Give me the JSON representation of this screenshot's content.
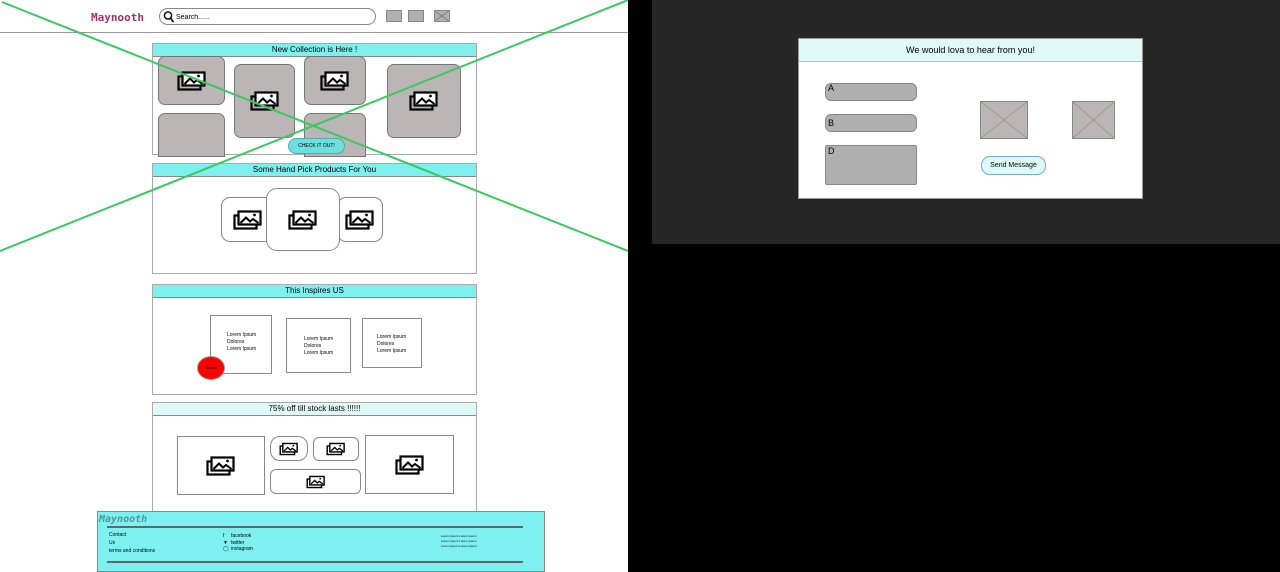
{
  "header": {
    "logo": "Maynooth",
    "search_placeholder": "Search......"
  },
  "sections": {
    "collection": {
      "title": "New Collection is Here !",
      "button": "CHECK IT OUT!"
    },
    "handpick": {
      "title": "Some Hand Pick Products For You"
    },
    "inspire": {
      "title": "This  Inspires US",
      "cards": [
        [
          "Lorem Ipsum",
          "Dolores",
          "Lorem Ipsum"
        ],
        [
          "Lorem Ipsum",
          "Dolores",
          "Lorem Ipsum"
        ],
        [
          "Lorem Ipsum",
          "Dolores",
          "Lorem Ipsum"
        ]
      ],
      "red_button": "Button"
    },
    "sale": {
      "title": "75% off till stock lasts !!!!!!"
    }
  },
  "footer": {
    "logo": "Maynooth",
    "links": [
      "Contact",
      "Us",
      "terms and conditions"
    ],
    "social": [
      "facebook",
      "twitter",
      "instagram"
    ],
    "lorem": [
      "Lorem ipsum Lorem ipsum",
      "Lorem ipsum Lorem ipsum",
      "Lorem ipsum Lorem ipsum"
    ]
  },
  "contact": {
    "title": "We would lova to hear from you!",
    "fields": [
      "A",
      "B",
      "D"
    ],
    "send_button": "Send Message"
  },
  "colors": {
    "accent": "#7ff0f0",
    "light_accent": "#dff9f9",
    "logo": "#a0306a",
    "cross": "#3cc860",
    "red": "#ff0000"
  },
  "icons": [
    "search-icon",
    "image-icon",
    "facebook-icon",
    "twitter-icon",
    "instagram-icon"
  ]
}
